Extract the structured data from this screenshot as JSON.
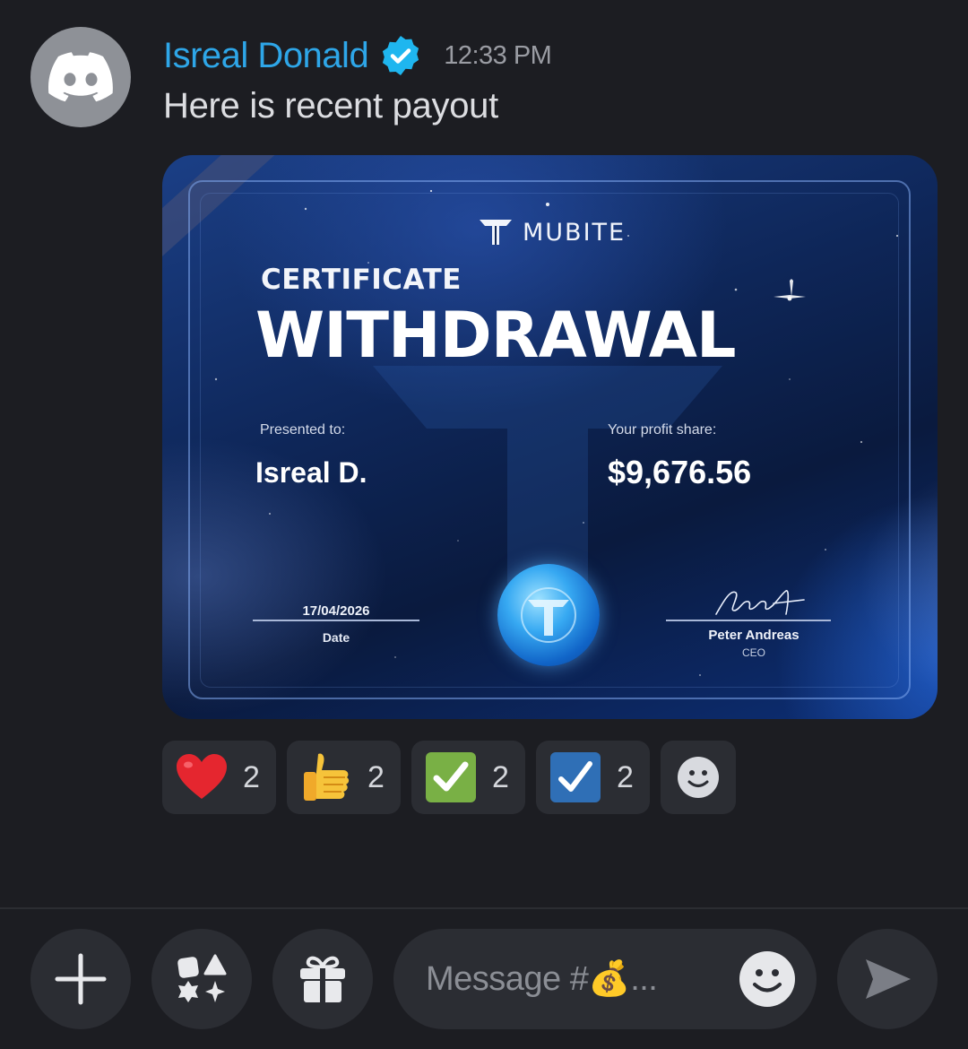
{
  "message": {
    "author": "Isreal Donald",
    "timestamp": "12:33 PM",
    "text": "Here is recent payout",
    "author_color": "#2ea6e8",
    "verified": true
  },
  "certificate": {
    "brand": "MUBITE",
    "subtitle": "CERTIFICATE",
    "title": "WITHDRAWAL",
    "presented_label": "Presented to:",
    "recipient": "Isreal D.",
    "profit_label": "Your profit share:",
    "profit_amount": "$9,676.56",
    "date_value": "17/04/2026",
    "date_label": "Date",
    "signature_text": "Andreas",
    "signer_name": "Peter Andreas",
    "signer_role": "CEO"
  },
  "reactions": [
    {
      "emoji": "heart-icon",
      "count": "2"
    },
    {
      "emoji": "thumbs-up-icon",
      "count": "2"
    },
    {
      "emoji": "green-check-icon",
      "count": "2"
    },
    {
      "emoji": "blue-check-icon",
      "count": "2"
    }
  ],
  "composer": {
    "placeholder": "Message #💰..."
  },
  "icons": {
    "add": "plus-icon",
    "apps": "apps-icon",
    "gift": "gift-icon",
    "emoji": "smiley-icon",
    "send": "send-icon"
  }
}
